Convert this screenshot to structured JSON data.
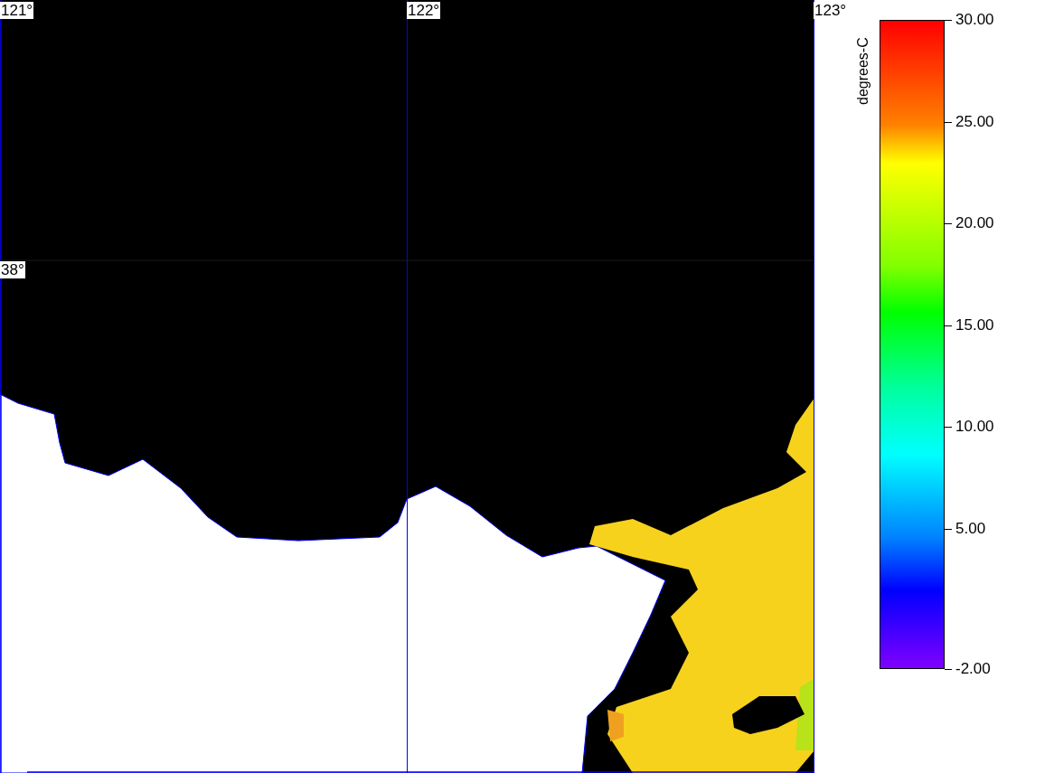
{
  "map": {
    "longitude_labels": [
      "121°",
      "122°",
      "123°"
    ],
    "latitude_labels": [
      "38°"
    ]
  },
  "colorbar": {
    "title": "degrees-C",
    "tick_labels": [
      "30.00",
      "25.00",
      "20.00",
      "15.00",
      "10.00",
      "5.00",
      "-2.00"
    ]
  }
}
